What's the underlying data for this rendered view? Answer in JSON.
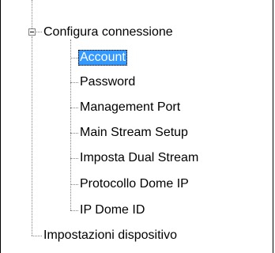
{
  "tree": {
    "root": {
      "label": "Configura connessione",
      "expanded": true
    },
    "children": [
      {
        "label": "Account",
        "selected": true
      },
      {
        "label": "Password"
      },
      {
        "label": "Management Port"
      },
      {
        "label": "Main Stream Setup"
      },
      {
        "label": "Imposta Dual Stream"
      },
      {
        "label": "Protocollo Dome IP"
      },
      {
        "label": "IP Dome ID"
      }
    ],
    "sibling": {
      "label": "Impostazioni dispositivo"
    }
  },
  "colors": {
    "selection_bg": "#3399ff",
    "selection_fg": "#ffffff",
    "tree_lines": "#808080"
  }
}
